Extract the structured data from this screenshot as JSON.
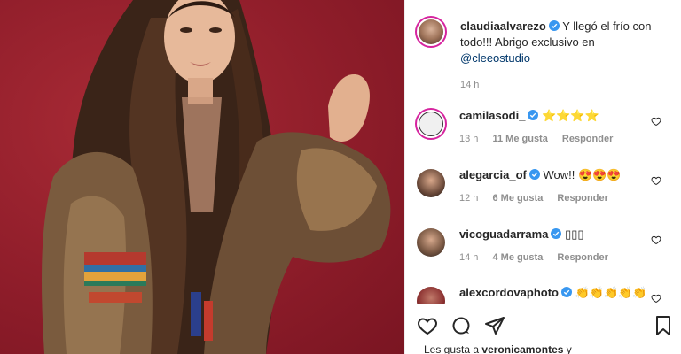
{
  "post": {
    "author": "claudiaalvarezo",
    "caption_part1": "Y llegó el frío con todo!!! Abrigo exclusivo en",
    "caption_mention": "@cleeostudio",
    "time": "14 h"
  },
  "comments": [
    {
      "user": "camilasodi_",
      "text": "⭐⭐⭐⭐",
      "time": "13 h",
      "likes": "11 Me gusta",
      "reply": "Responder"
    },
    {
      "user": "alegarcia_of",
      "text": "Wow!! 😍😍😍",
      "time": "12 h",
      "likes": "6 Me gusta",
      "reply": "Responder"
    },
    {
      "user": "vicoguadarrama",
      "text": "▯▯▯",
      "time": "14 h",
      "likes": "4 Me gusta",
      "reply": "Responder"
    },
    {
      "user": "alexcordovaphoto",
      "text": "👏👏👏👏👏",
      "time": "",
      "likes": "",
      "reply": ""
    }
  ],
  "likes_line": {
    "prefix": "Les gusta a",
    "user": "veronicamontes",
    "suffix": "y"
  },
  "icons": {
    "like": "heart-icon",
    "comment": "comment-icon",
    "share": "share-icon",
    "save": "bookmark-icon",
    "verified": "verified-badge-icon"
  },
  "colors": {
    "background_photo": "#8f1d2a",
    "verified": "#3897f0",
    "mention": "#00376b",
    "secondary_text": "#8e8e8e"
  }
}
